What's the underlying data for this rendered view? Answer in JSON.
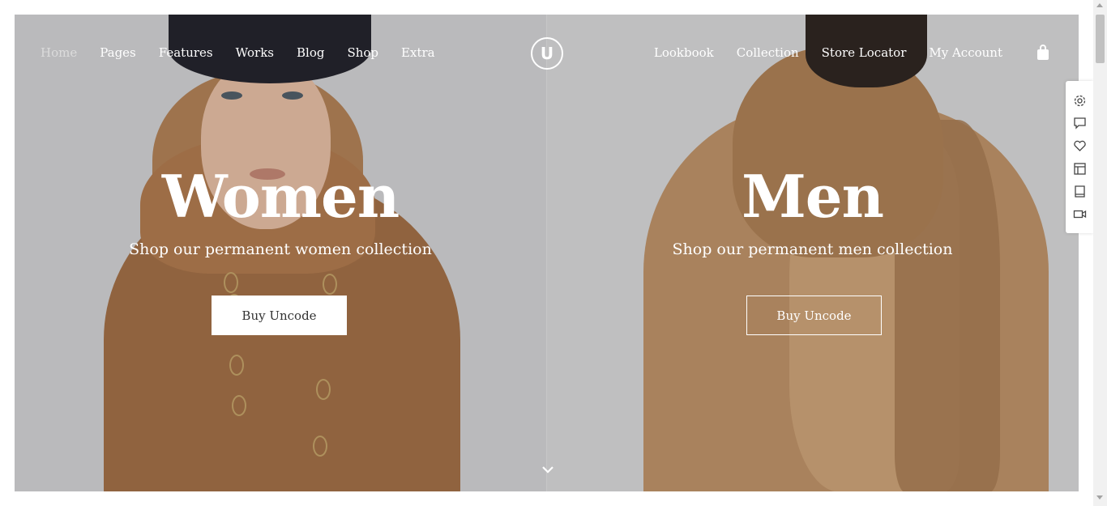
{
  "nav": {
    "left": [
      "Home",
      "Pages",
      "Features",
      "Works",
      "Blog",
      "Shop",
      "Extra"
    ],
    "right": [
      "Lookbook",
      "Collection",
      "Store Locator",
      "My Account"
    ],
    "logo_letter": "U",
    "cart_icon": "shopping-bag-icon"
  },
  "hero": {
    "women": {
      "title": "Women",
      "subtitle": "Shop our permanent women collection",
      "button": "Buy Uncode"
    },
    "men": {
      "title": "Men",
      "subtitle": "Shop our permanent men collection",
      "button": "Buy Uncode"
    }
  },
  "scroll_icon": "chevron-down-icon",
  "side_toolbar": [
    "gear-icon",
    "comment-icon",
    "heart-icon",
    "layout-icon",
    "book-icon",
    "video-icon"
  ],
  "colors": {
    "accent_text": "#ffffff",
    "button_text": "#333333"
  }
}
